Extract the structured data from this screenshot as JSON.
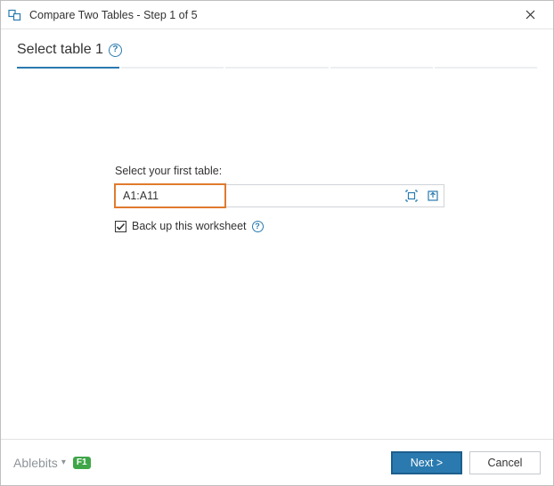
{
  "window": {
    "title": "Compare Two Tables - Step 1 of 5"
  },
  "header": {
    "step_title": "Select table 1"
  },
  "progress": {
    "total": 5,
    "current": 1
  },
  "form": {
    "select_label": "Select your first table:",
    "range_value": "A1:A11",
    "backup_label": "Back up this worksheet",
    "backup_checked": true
  },
  "footer": {
    "brand": "Ablebits",
    "help_key": "F1",
    "next_label": "Next >",
    "cancel_label": "Cancel"
  }
}
